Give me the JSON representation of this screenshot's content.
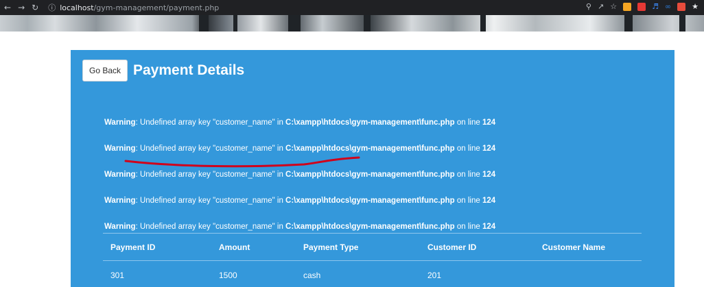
{
  "browser": {
    "url_host": "localhost",
    "url_path": "/gym-management/payment.php",
    "extension_colors": [
      "#f5a623",
      "#e53935",
      "#3d8bfd",
      "#2ecc71",
      "#e74c3c",
      "#9b59b6"
    ]
  },
  "header": {
    "go_back_label": "Go Back",
    "title": "Payment Details"
  },
  "warnings": [
    {
      "label": "Warning",
      "message": ": Undefined array key \"customer_name\" in ",
      "file": "C:\\xampp\\htdocs\\gym-management\\func.php",
      "line_prefix": " on line ",
      "line": "124"
    },
    {
      "label": "Warning",
      "message": ": Undefined array key \"customer_name\" in ",
      "file": "C:\\xampp\\htdocs\\gym-management\\func.php",
      "line_prefix": " on line ",
      "line": "124"
    },
    {
      "label": "Warning",
      "message": ": Undefined array key \"customer_name\" in ",
      "file": "C:\\xampp\\htdocs\\gym-management\\func.php",
      "line_prefix": " on line ",
      "line": "124"
    },
    {
      "label": "Warning",
      "message": ": Undefined array key \"customer_name\" in ",
      "file": "C:\\xampp\\htdocs\\gym-management\\func.php",
      "line_prefix": " on line ",
      "line": "124"
    },
    {
      "label": "Warning",
      "message": ": Undefined array key \"customer_name\" in ",
      "file": "C:\\xampp\\htdocs\\gym-management\\func.php",
      "line_prefix": " on line ",
      "line": "124"
    }
  ],
  "table": {
    "headers": [
      "Payment ID",
      "Amount",
      "Payment Type",
      "Customer ID",
      "Customer Name"
    ],
    "rows": [
      [
        "301",
        "1500",
        "cash",
        "201",
        ""
      ]
    ]
  },
  "colors": {
    "panel": "#3498db",
    "annotation": "#d0021b"
  }
}
